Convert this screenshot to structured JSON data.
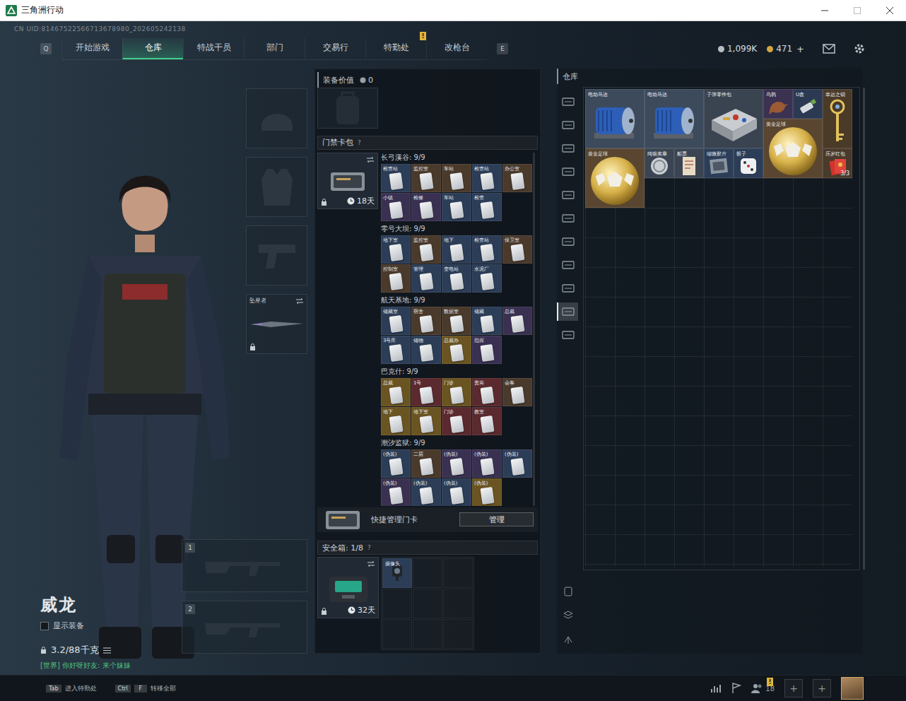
{
  "window": {
    "title": "三角洲行动"
  },
  "uid": "CN UID:81467522566713678980_202605242138",
  "nav": {
    "prev_key": "Q",
    "next_key": "E",
    "tabs": [
      {
        "label": "开始游戏",
        "selected": false,
        "badge": ""
      },
      {
        "label": "仓库",
        "selected": true,
        "badge": ""
      },
      {
        "label": "特战干员",
        "selected": false,
        "badge": ""
      },
      {
        "label": "部门",
        "selected": false,
        "badge": ""
      },
      {
        "label": "交易行",
        "selected": false,
        "badge": ""
      },
      {
        "label": "特勤处",
        "selected": false,
        "badge": "!"
      },
      {
        "label": "改枪台",
        "selected": false,
        "badge": ""
      }
    ]
  },
  "currencies": [
    {
      "amount": "1,099K",
      "kind": "coin"
    },
    {
      "amount": "471",
      "kind": "gem"
    }
  ],
  "add_currency": "+",
  "operator": {
    "name": "威龙",
    "show_equipment": {
      "label": "显示装备",
      "checked": false
    },
    "weight": "3.2/88千克",
    "chat": "[世界] 你好呀好友: 来个妹妹"
  },
  "equipment": {
    "melee": {
      "label": "坠星者",
      "locked": true
    }
  },
  "weapon_slots": [
    "1",
    "2"
  ],
  "loadout": {
    "label": "装备价值",
    "value": "0"
  },
  "keycard_bag": {
    "title": "门禁卡包",
    "help": "?",
    "locked": true,
    "duration": "18天",
    "groups": [
      {
        "map": "长弓溪谷: 9/9",
        "cards": [
          {
            "label": "检查站",
            "color": "#2c3d57"
          },
          {
            "label": "监控室",
            "color": "#4a3a2c"
          },
          {
            "label": "车站",
            "color": "#4a3a2c"
          },
          {
            "label": "检查站",
            "color": "#2c3d57"
          },
          {
            "label": "办公室",
            "color": "#4a3a2c"
          },
          {
            "label": "小镇",
            "color": "#3a3152"
          },
          {
            "label": "检修",
            "color": "#3a3152"
          },
          {
            "label": "车站",
            "color": "#2c3d57"
          },
          {
            "label": "检查",
            "color": "#2c3d57"
          }
        ]
      },
      {
        "map": "零号大坝: 9/9",
        "cards": [
          {
            "label": "地下室",
            "color": "#2c3d57"
          },
          {
            "label": "监控室",
            "color": "#4a3a2c"
          },
          {
            "label": "地下",
            "color": "#2c3d57"
          },
          {
            "label": "检查站",
            "color": "#2c3d57"
          },
          {
            "label": "保卫室",
            "color": "#4a3a2c"
          },
          {
            "label": "控制室",
            "color": "#4a3a2c"
          },
          {
            "label": "管理",
            "color": "#2c3d57"
          },
          {
            "label": "变电站",
            "color": "#2c3d57"
          },
          {
            "label": "水泥厂",
            "color": "#2c3d57"
          }
        ]
      },
      {
        "map": "航天基地: 9/9",
        "cards": [
          {
            "label": "储藏室",
            "color": "#2c3d57"
          },
          {
            "label": "宿舍",
            "color": "#4a3a2c"
          },
          {
            "label": "数据室",
            "color": "#4a3a2c"
          },
          {
            "label": "储藏",
            "color": "#2c3d57"
          },
          {
            "label": "总裁",
            "color": "#3a3152"
          },
          {
            "label": "3号库",
            "color": "#2c3d57"
          },
          {
            "label": "储物",
            "color": "#2c3d57"
          },
          {
            "label": "总裁办",
            "color": "#6a5422"
          },
          {
            "label": "指挥",
            "color": "#3a3152"
          }
        ]
      },
      {
        "map": "巴克什: 9/9",
        "cards": [
          {
            "label": "总裁",
            "color": "#6a5422"
          },
          {
            "label": "1号",
            "color": "#5a2a2e"
          },
          {
            "label": "门诊",
            "color": "#6a5422"
          },
          {
            "label": "贵宾",
            "color": "#5a2a2e"
          },
          {
            "label": "会客",
            "color": "#4a3a2c"
          },
          {
            "label": "地下",
            "color": "#6a5422"
          },
          {
            "label": "地下室",
            "color": "#6a5422"
          },
          {
            "label": "门诊",
            "color": "#5a2a2e"
          },
          {
            "label": "教室",
            "color": "#5a2a2e"
          }
        ]
      },
      {
        "map": "潮汐监狱: 9/9",
        "cards": [
          {
            "label": "(伪装)",
            "color": "#2c3d57"
          },
          {
            "label": "二层",
            "color": "#4a3a2c"
          },
          {
            "label": "(伪装)",
            "color": "#3a3152"
          },
          {
            "label": "(伪装)",
            "color": "#3a3152"
          },
          {
            "label": "(伪装)",
            "color": "#2c3d57"
          },
          {
            "label": "(伪装)",
            "color": "#3a3152"
          },
          {
            "label": "(伪装)",
            "color": "#2c3d57"
          },
          {
            "label": "(伪装)",
            "color": "#2c3d57"
          },
          {
            "label": "(伪装)",
            "color": "#6a5422"
          }
        ]
      }
    ]
  },
  "quick_manage": {
    "label": "快捷管理门卡",
    "button": "管理"
  },
  "safe_box": {
    "title": "安全箱: 1/8",
    "help": "?",
    "locked": true,
    "duration": "32天",
    "items": [
      {
        "label": "摄像头",
        "color": "#2c3d57"
      }
    ]
  },
  "storage": {
    "title": "仓库",
    "tabs": [
      {
        "selected": false
      },
      {
        "selected": false
      },
      {
        "selected": false
      },
      {
        "selected": false
      },
      {
        "selected": false
      },
      {
        "selected": false
      },
      {
        "selected": false
      },
      {
        "selected": false
      },
      {
        "selected": false
      },
      {
        "selected": true
      },
      {
        "selected": false
      }
    ],
    "items": [
      {
        "label": "电动马达",
        "kind": "motor",
        "color": "#3c4a5c"
      },
      {
        "label": "电动马达",
        "kind": "motor",
        "color": "#3c4a5c"
      },
      {
        "label": "子弹零件包",
        "kind": "kit",
        "color": "#3a4350"
      },
      {
        "label": "乌鸦",
        "kind": "bird",
        "color": "#3b3150"
      },
      {
        "label": "U盘",
        "kind": "usb",
        "color": "#2b3a52"
      },
      {
        "label": "幸运之钥",
        "kind": "key",
        "color": "#4a3a28"
      },
      {
        "label": "黄金足球",
        "kind": "ball",
        "color": "#5a4630"
      },
      {
        "label": "黄金足球",
        "kind": "ball",
        "color": "#5a4630"
      },
      {
        "label": "纯银奖章",
        "kind": "coin",
        "color": "#3a4452"
      },
      {
        "label": "船票",
        "kind": "ticket",
        "color": "#3a4452"
      },
      {
        "label": "缩微胶片",
        "kind": "photo",
        "color": "#2c3d57"
      },
      {
        "label": "骰子",
        "kind": "dice",
        "color": "#2c3d57"
      },
      {
        "label": "压岁红包",
        "kind": "envelope",
        "color": "#4a3a2c",
        "count": "3/3"
      }
    ]
  },
  "bottom_bar": {
    "hints": [
      {
        "keys": [
          "Tab"
        ],
        "label": "进入特勤处"
      },
      {
        "keys": [
          "Ctrl",
          "F"
        ],
        "label": "转移全部"
      }
    ],
    "friends": "18",
    "friends_badge": "!",
    "slots": [
      "+",
      "+"
    ]
  }
}
